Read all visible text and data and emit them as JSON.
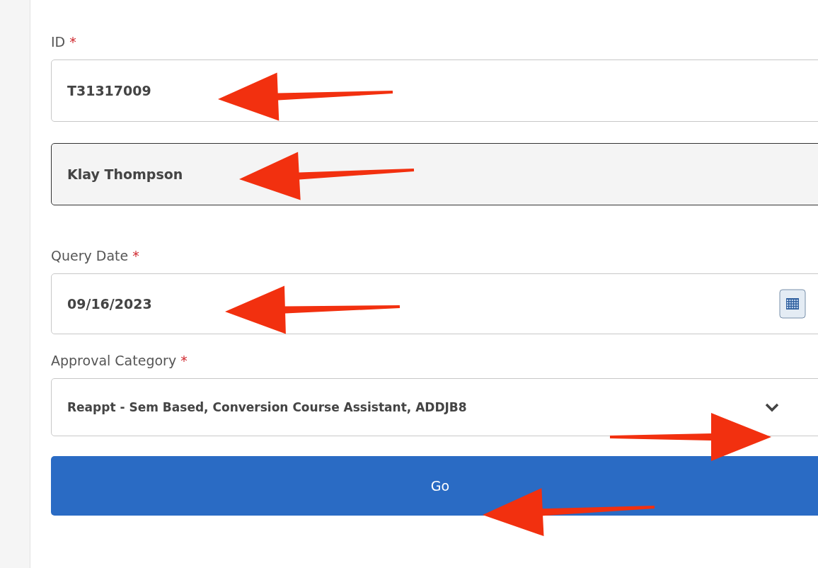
{
  "fields": [
    {
      "kind": "text",
      "label": "ID",
      "required_mark": "*",
      "value": "T31317009"
    },
    {
      "kind": "readonly",
      "value": "Klay Thompson"
    },
    {
      "kind": "date",
      "label": "Query Date",
      "required_mark": "*",
      "value": "09/16/2023"
    },
    {
      "kind": "select",
      "label": "Approval Category",
      "required_mark": "*",
      "value": "Reappt - Sem Based, Conversion Course Assistant, ADDJB8"
    }
  ],
  "submit": {
    "label": "Go"
  }
}
